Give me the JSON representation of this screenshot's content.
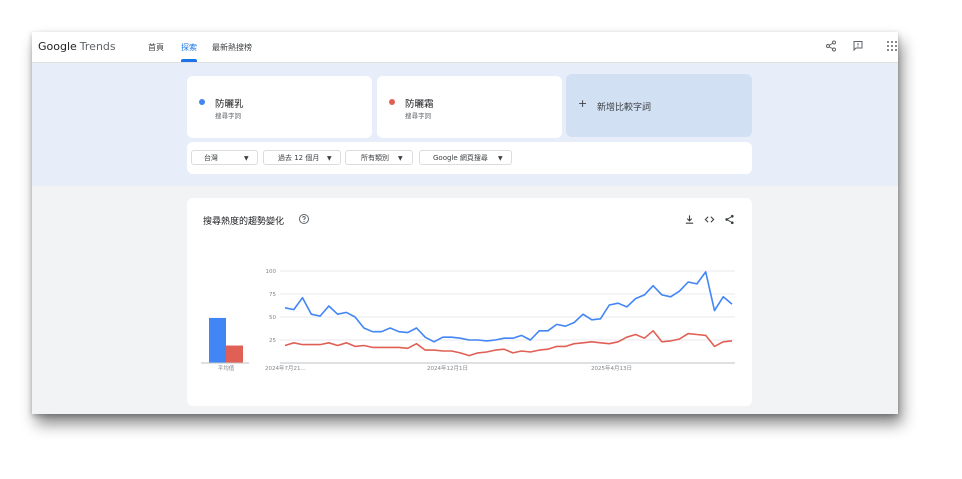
{
  "header": {
    "logo_google": "Google",
    "logo_trends": "Trends",
    "tabs": [
      {
        "label": "首頁"
      },
      {
        "label": "探索"
      },
      {
        "label": "最新熱搜榜"
      }
    ],
    "icons": [
      "share-icon",
      "feedback-icon",
      "apps-grid-icon"
    ]
  },
  "terms": [
    {
      "name": "防曬乳",
      "type": "搜尋字詞",
      "color": "#4285f4"
    },
    {
      "name": "防曬霜",
      "type": "搜尋字詞",
      "color": "#e06055"
    }
  ],
  "add_term": {
    "label": "新增比較字詞",
    "icon": "plus-icon"
  },
  "filters": [
    {
      "label": "台灣"
    },
    {
      "label": "過去 12 個月"
    },
    {
      "label": "所有類別"
    },
    {
      "label": "Google 網頁搜尋"
    }
  ],
  "chart": {
    "title": "搜尋熱度的趨勢變化",
    "icons": [
      "download-icon",
      "embed-icon",
      "share-icon"
    ]
  },
  "chart_data": {
    "type": "line",
    "y_ticks": [
      "100",
      "75",
      "50",
      "25"
    ],
    "x_tick_labels": [
      "2024年7月21...",
      "2024年12月1日",
      "2025年4月13日"
    ],
    "ylim": [
      0,
      100
    ],
    "grid": true,
    "average_bar": {
      "label": "平均值",
      "values": [
        49,
        19
      ]
    },
    "series": [
      {
        "color": "#4285f4",
        "values": [
          60,
          58,
          71,
          53,
          51,
          62,
          53,
          55,
          50,
          38,
          34,
          34,
          38,
          34,
          33,
          38,
          28,
          23,
          28,
          28,
          27,
          25,
          25,
          24,
          25,
          27,
          27,
          30,
          25,
          35,
          35,
          42,
          40,
          44,
          53,
          47,
          48,
          63,
          65,
          61,
          70,
          74,
          84,
          74,
          72,
          78,
          88,
          86,
          99,
          57,
          72,
          64
        ]
      },
      {
        "color": "#e06055",
        "values": [
          19,
          22,
          20,
          20,
          20,
          22,
          19,
          22,
          18,
          19,
          17,
          17,
          17,
          17,
          16,
          21,
          14,
          14,
          13,
          13,
          11,
          8,
          11,
          12,
          14,
          15,
          11,
          13,
          12,
          14,
          15,
          18,
          18,
          21,
          22,
          23,
          22,
          21,
          23,
          28,
          31,
          27,
          35,
          23,
          24,
          26,
          32,
          31,
          30,
          18,
          23,
          24
        ]
      }
    ]
  }
}
